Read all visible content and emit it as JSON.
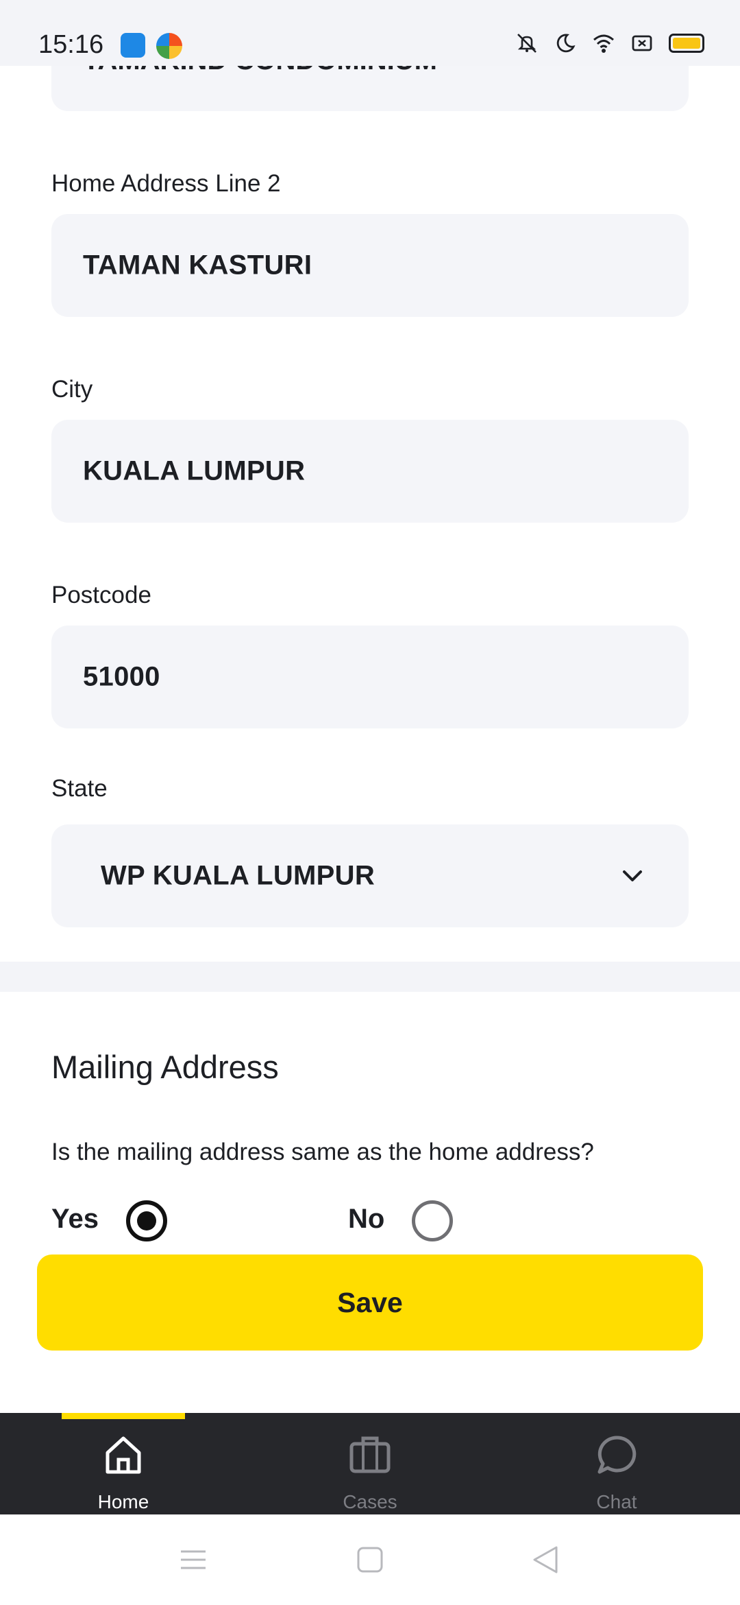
{
  "status_bar": {
    "time": "15:16",
    "icons": [
      "android-app-icon",
      "browser-app-icon",
      "vibrate-off-icon",
      "moon-icon",
      "wifi-icon",
      "sim-off-icon",
      "battery-icon"
    ],
    "battery_color": "#f9c513"
  },
  "form": {
    "address_line1_clipped": "TAMARIND CONDOMINIUM",
    "address_line2": {
      "label": "Home Address Line 2",
      "value": "TAMAN KASTURI"
    },
    "city": {
      "label": "City",
      "value": "KUALA LUMPUR"
    },
    "postcode": {
      "label": "Postcode",
      "value": "51000"
    },
    "state": {
      "label": "State",
      "value": "WP KUALA LUMPUR"
    }
  },
  "mailing": {
    "title": "Mailing Address",
    "question": "Is the mailing address same as the home address?",
    "options": [
      {
        "label": "Yes",
        "selected": true
      },
      {
        "label": "No",
        "selected": false
      }
    ]
  },
  "save_label": "Save",
  "accent_color": "#ffdd00",
  "bottom_nav": {
    "items": [
      {
        "label": "Home",
        "icon": "home-icon",
        "active": true
      },
      {
        "label": "Cases",
        "icon": "briefcase-icon",
        "active": false
      },
      {
        "label": "Chat",
        "icon": "chat-bubble-icon",
        "active": false
      }
    ]
  },
  "system_nav": [
    "menu-icon",
    "home-square-icon",
    "back-triangle-icon"
  ]
}
